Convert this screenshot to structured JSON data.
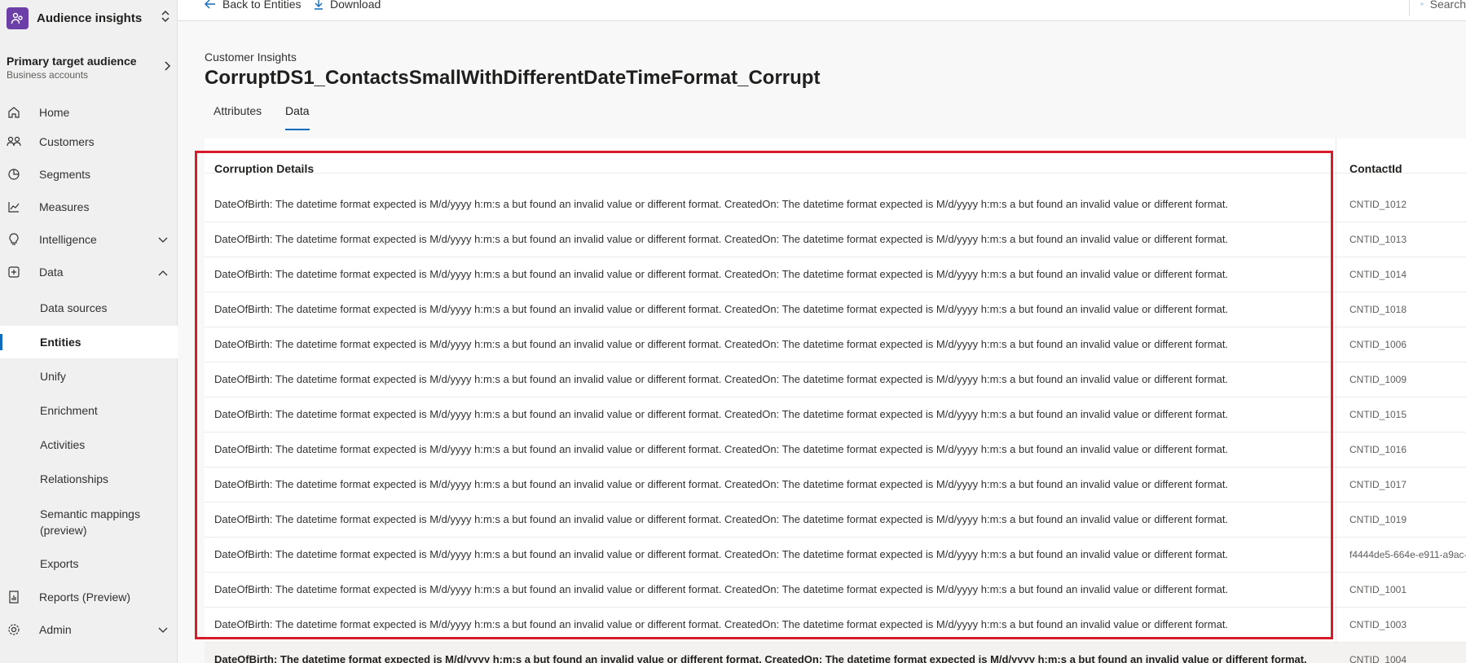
{
  "app": {
    "title": "Audience insights"
  },
  "audience": {
    "title": "Primary target audience",
    "subtitle": "Business accounts"
  },
  "nav": {
    "home": "Home",
    "customers": "Customers",
    "segments": "Segments",
    "measures": "Measures",
    "intelligence": "Intelligence",
    "data": "Data",
    "data_sources": "Data sources",
    "entities": "Entities",
    "unify": "Unify",
    "enrichment": "Enrichment",
    "activities": "Activities",
    "relationships": "Relationships",
    "semantic_mappings_1": "Semantic mappings",
    "semantic_mappings_2": "(preview)",
    "exports": "Exports",
    "reports": "Reports (Preview)",
    "admin": "Admin"
  },
  "toolbar": {
    "back": "Back to Entities",
    "download": "Download",
    "search": "Search"
  },
  "breadcrumb": "Customer Insights",
  "page_title": "CorruptDS1_ContactsSmallWithDifferentDateTimeFormat_Corrupt",
  "tabs": {
    "attributes": "Attributes",
    "data": "Data"
  },
  "table": {
    "columns": [
      "Corruption Details",
      "ContactId"
    ],
    "rows": [
      [
        "DateOfBirth: The datetime format expected is M/d/yyyy h:m:s a but found an invalid value or different format. CreatedOn: The datetime format expected is M/d/yyyy h:m:s a but found an invalid value or different format.",
        "CNTID_1012"
      ],
      [
        "DateOfBirth: The datetime format expected is M/d/yyyy h:m:s a but found an invalid value or different format. CreatedOn: The datetime format expected is M/d/yyyy h:m:s a but found an invalid value or different format.",
        "CNTID_1013"
      ],
      [
        "DateOfBirth: The datetime format expected is M/d/yyyy h:m:s a but found an invalid value or different format. CreatedOn: The datetime format expected is M/d/yyyy h:m:s a but found an invalid value or different format.",
        "CNTID_1014"
      ],
      [
        "DateOfBirth: The datetime format expected is M/d/yyyy h:m:s a but found an invalid value or different format. CreatedOn: The datetime format expected is M/d/yyyy h:m:s a but found an invalid value or different format.",
        "CNTID_1018"
      ],
      [
        "DateOfBirth: The datetime format expected is M/d/yyyy h:m:s a but found an invalid value or different format. CreatedOn: The datetime format expected is M/d/yyyy h:m:s a but found an invalid value or different format.",
        "CNTID_1006"
      ],
      [
        "DateOfBirth: The datetime format expected is M/d/yyyy h:m:s a but found an invalid value or different format. CreatedOn: The datetime format expected is M/d/yyyy h:m:s a but found an invalid value or different format.",
        "CNTID_1009"
      ],
      [
        "DateOfBirth: The datetime format expected is M/d/yyyy h:m:s a but found an invalid value or different format. CreatedOn: The datetime format expected is M/d/yyyy h:m:s a but found an invalid value or different format.",
        "CNTID_1015"
      ],
      [
        "DateOfBirth: The datetime format expected is M/d/yyyy h:m:s a but found an invalid value or different format. CreatedOn: The datetime format expected is M/d/yyyy h:m:s a but found an invalid value or different format.",
        "CNTID_1016"
      ],
      [
        "DateOfBirth: The datetime format expected is M/d/yyyy h:m:s a but found an invalid value or different format. CreatedOn: The datetime format expected is M/d/yyyy h:m:s a but found an invalid value or different format.",
        "CNTID_1017"
      ],
      [
        "DateOfBirth: The datetime format expected is M/d/yyyy h:m:s a but found an invalid value or different format. CreatedOn: The datetime format expected is M/d/yyyy h:m:s a but found an invalid value or different format.",
        "CNTID_1019"
      ],
      [
        "DateOfBirth: The datetime format expected is M/d/yyyy h:m:s a but found an invalid value or different format. CreatedOn: The datetime format expected is M/d/yyyy h:m:s a but found an invalid value or different format.",
        "f4444de5-664e-e911-a9ac-"
      ],
      [
        "DateOfBirth: The datetime format expected is M/d/yyyy h:m:s a but found an invalid value or different format. CreatedOn: The datetime format expected is M/d/yyyy h:m:s a but found an invalid value or different format.",
        "CNTID_1001"
      ],
      [
        "DateOfBirth: The datetime format expected is M/d/yyyy h:m:s a but found an invalid value or different format. CreatedOn: The datetime format expected is M/d/yyyy h:m:s a but found an invalid value or different format.",
        "CNTID_1003"
      ],
      [
        "DateOfBirth: The datetime format expected is M/d/yyyy h:m:s a but found an invalid value or different format. CreatedOn: The datetime format expected is M/d/yyyy h:m:s a but found an invalid value or different format.",
        "CNTID_1004"
      ]
    ]
  },
  "colors": {
    "accent": "#0f6cbd",
    "highlight": "#d81b2b",
    "app_logo": "#6b3ea8"
  }
}
